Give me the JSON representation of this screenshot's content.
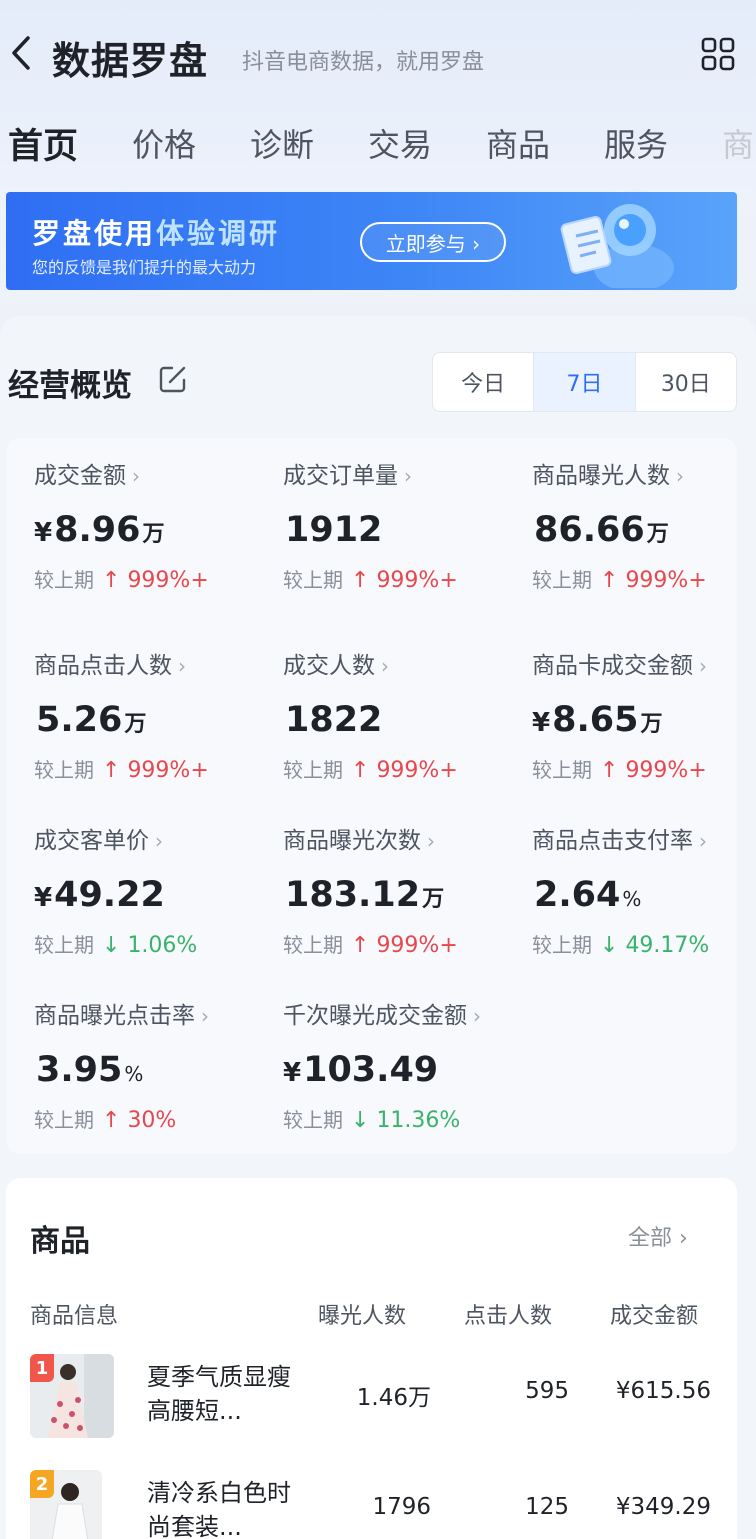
{
  "header": {
    "title": "数据罗盘",
    "subtitle": "抖音电商数据，就用罗盘"
  },
  "tabs": [
    "首页",
    "价格",
    "诊断",
    "交易",
    "商品",
    "服务",
    "商"
  ],
  "banner": {
    "title_part1": "罗盘使用",
    "title_part2": "体验调研",
    "subtitle": "您的反馈是我们提升的最大动力",
    "button": "立即参与 ›"
  },
  "overview": {
    "title": "经营概览",
    "periods": [
      "今日",
      "7日",
      "30日"
    ],
    "active_period": "7日",
    "compare_label": "较上期",
    "metrics": [
      {
        "label": "成交金额",
        "currency": "¥",
        "value": "8.96",
        "unit": "万",
        "arrow": "↑",
        "delta": "999%+",
        "dir": "up"
      },
      {
        "label": "成交订单量",
        "currency": "",
        "value": "1912",
        "unit": "",
        "arrow": "↑",
        "delta": "999%+",
        "dir": "up"
      },
      {
        "label": "商品曝光人数",
        "currency": "",
        "value": "86.66",
        "unit": "万",
        "arrow": "↑",
        "delta": "999%+",
        "dir": "up"
      },
      {
        "label": "商品点击人数",
        "currency": "",
        "value": "5.26",
        "unit": "万",
        "arrow": "↑",
        "delta": "999%+",
        "dir": "up"
      },
      {
        "label": "成交人数",
        "currency": "",
        "value": "1822",
        "unit": "",
        "arrow": "↑",
        "delta": "999%+",
        "dir": "up"
      },
      {
        "label": "商品卡成交金额",
        "currency": "¥",
        "value": "8.65",
        "unit": "万",
        "arrow": "↑",
        "delta": "999%+",
        "dir": "up"
      },
      {
        "label": "成交客单价",
        "currency": "¥",
        "value": "49.22",
        "unit": "",
        "arrow": "↓",
        "delta": "1.06%",
        "dir": "down"
      },
      {
        "label": "商品曝光次数",
        "currency": "",
        "value": "183.12",
        "unit": "万",
        "arrow": "↑",
        "delta": "999%+",
        "dir": "up"
      },
      {
        "label": "商品点击支付率",
        "currency": "",
        "value": "2.64",
        "unit": "%",
        "arrow": "↓",
        "delta": "49.17%",
        "dir": "down"
      },
      {
        "label": "商品曝光点击率",
        "currency": "",
        "value": "3.95",
        "unit": "%",
        "arrow": "↑",
        "delta": "30%",
        "dir": "up"
      },
      {
        "label": "千次曝光成交金额",
        "currency": "¥",
        "value": "103.49",
        "unit": "",
        "arrow": "↓",
        "delta": "11.36%",
        "dir": "down"
      }
    ]
  },
  "goods": {
    "title": "商品",
    "all_link": "全部 ›",
    "columns": [
      "商品信息",
      "曝光人数",
      "点击人数",
      "成交金额"
    ],
    "rows": [
      {
        "rank": "1",
        "name": "夏季气质显瘦高腰短...",
        "exposure": "1.46万",
        "clicks": "595",
        "amount": "¥615.56"
      },
      {
        "rank": "2",
        "name": "清冷系白色时尚套装...",
        "exposure": "1796",
        "clicks": "125",
        "amount": "¥349.29"
      }
    ]
  },
  "colors": {
    "accent": "#2f6ef3",
    "up": "#e5484d",
    "down": "#39b36b",
    "rank1": "#f0564c",
    "rank2": "#f5a623"
  },
  "icons": [
    "back-icon",
    "grid-icon",
    "edit-icon",
    "survey-illustration"
  ]
}
